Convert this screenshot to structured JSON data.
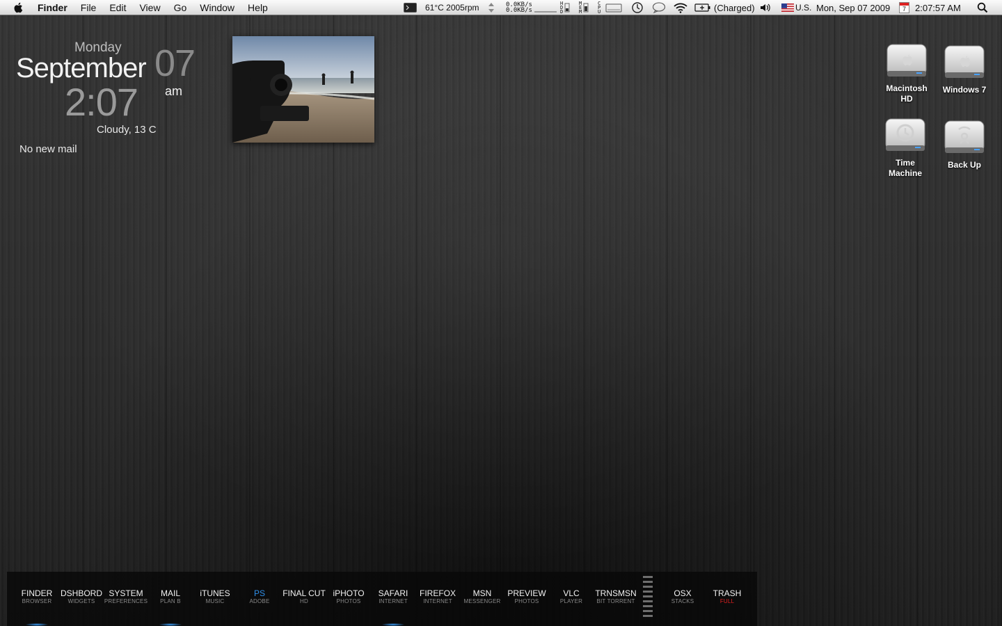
{
  "menubar": {
    "app_name": "Finder",
    "menus": [
      "File",
      "Edit",
      "View",
      "Go",
      "Window",
      "Help"
    ],
    "status": {
      "temp_fan": "61°C 2005rpm",
      "net_up": "0.0KB/s",
      "net_down": "0.0KB/s",
      "hdd_letters": "HDD",
      "mem_letters": "MEM",
      "cpu_letters": "CPU",
      "battery": "(Charged)",
      "input_language": "U.S.",
      "date": "Mon, Sep 07 2009",
      "calendar_day": "7",
      "time": "2:07:57 AM"
    }
  },
  "clock": {
    "day": "Monday",
    "month": "September",
    "date": "07",
    "time": "2:07",
    "ampm": "am",
    "weather": "Cloudy, 13 C"
  },
  "mail": {
    "status": "No new mail"
  },
  "desktop_icons": [
    {
      "label_lines": [
        "Macintosh",
        "HD"
      ],
      "kind": "internal-drive"
    },
    {
      "label_lines": [
        "Windows 7"
      ],
      "kind": "internal-drive"
    },
    {
      "label_lines": [
        "Time",
        "Machine"
      ],
      "kind": "time-machine-drive"
    },
    {
      "label_lines": [
        "Back Up"
      ],
      "kind": "firewire-drive"
    }
  ],
  "dock": {
    "items": [
      {
        "label": "FINDER",
        "sub": "BROWSER",
        "running": true
      },
      {
        "label": "DSHBORD",
        "sub": "WIDGETS",
        "running": false
      },
      {
        "label": "SYSTEM",
        "sub": "PREFERENCES",
        "running": false
      },
      {
        "label": "MAIL",
        "sub": "PLAN B",
        "running": true
      },
      {
        "label": "iTUNES",
        "sub": "MUSIC",
        "running": false
      },
      {
        "label": "PS",
        "sub": "ADOBE",
        "running": false,
        "accent": "#2f8fe8"
      },
      {
        "label": "FINAL CUT",
        "sub": "HD",
        "running": false
      },
      {
        "label": "iPHOTO",
        "sub": "PHOTOS",
        "running": false
      },
      {
        "label": "SAFARI",
        "sub": "INTERNET",
        "running": true
      },
      {
        "label": "FIREFOX",
        "sub": "INTERNET",
        "running": false
      },
      {
        "label": "MSN",
        "sub": "MESSENGER",
        "running": false
      },
      {
        "label": "PREVIEW",
        "sub": "PHOTOS",
        "running": false
      },
      {
        "label": "VLC",
        "sub": "PLAYER",
        "running": false
      },
      {
        "label": "TRNSMSN",
        "sub": "BIT TORRENT",
        "running": false
      },
      {
        "label": "OSX",
        "sub": "STACKS",
        "running": false
      },
      {
        "label": "TRASH",
        "sub": "FULL",
        "running": false,
        "sub_color": "#e02020"
      }
    ]
  },
  "colors": {
    "running_indicator": "#3aa0ff",
    "trash_full": "#e02020",
    "ps_accent": "#2f8fe8"
  }
}
